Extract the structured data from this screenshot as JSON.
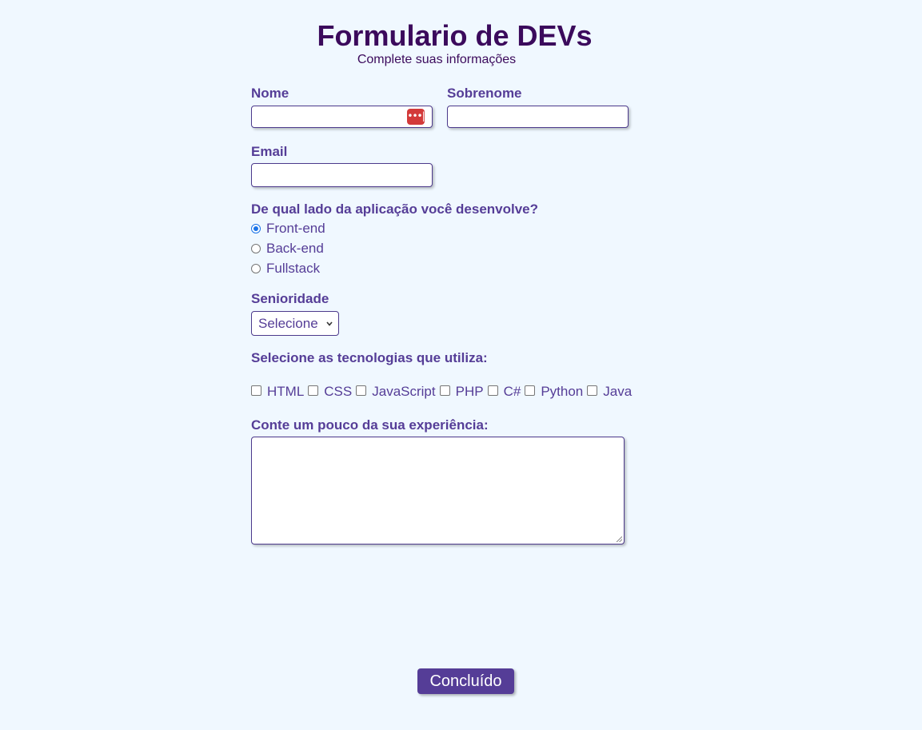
{
  "header": {
    "title": "Formulario de DEVs",
    "subtitle": "Complete suas informações"
  },
  "form": {
    "nome_label": "Nome",
    "sobrenome_label": "Sobrenome",
    "email_label": "Email",
    "lado_question": "De qual lado da aplicação você desenvolve?",
    "lado_options": [
      {
        "label": "Front-end",
        "checked": true
      },
      {
        "label": "Back-end",
        "checked": false
      },
      {
        "label": "Fullstack",
        "checked": false
      }
    ],
    "senioridade_label": "Senioridade",
    "senioridade_value": "Selecione",
    "tecnologias_label": "Selecione as tecnologias que utiliza:",
    "tecnologias": [
      "HTML",
      "CSS",
      "JavaScript",
      "PHP",
      "C#",
      "Python",
      "Java"
    ],
    "experiencia_label": "Conte um pouco da sua experiência:",
    "submit_label": "Concluído"
  },
  "icons": {
    "password_manager": "password-manager-icon",
    "select_chevron": "chevron-down-icon"
  },
  "colors": {
    "background": "#f0f8ff",
    "title": "#3b0a5c",
    "label": "#553d97",
    "button": "#553d97",
    "password_icon": "#d33a3a",
    "radio_checked": "#1a73e8"
  }
}
